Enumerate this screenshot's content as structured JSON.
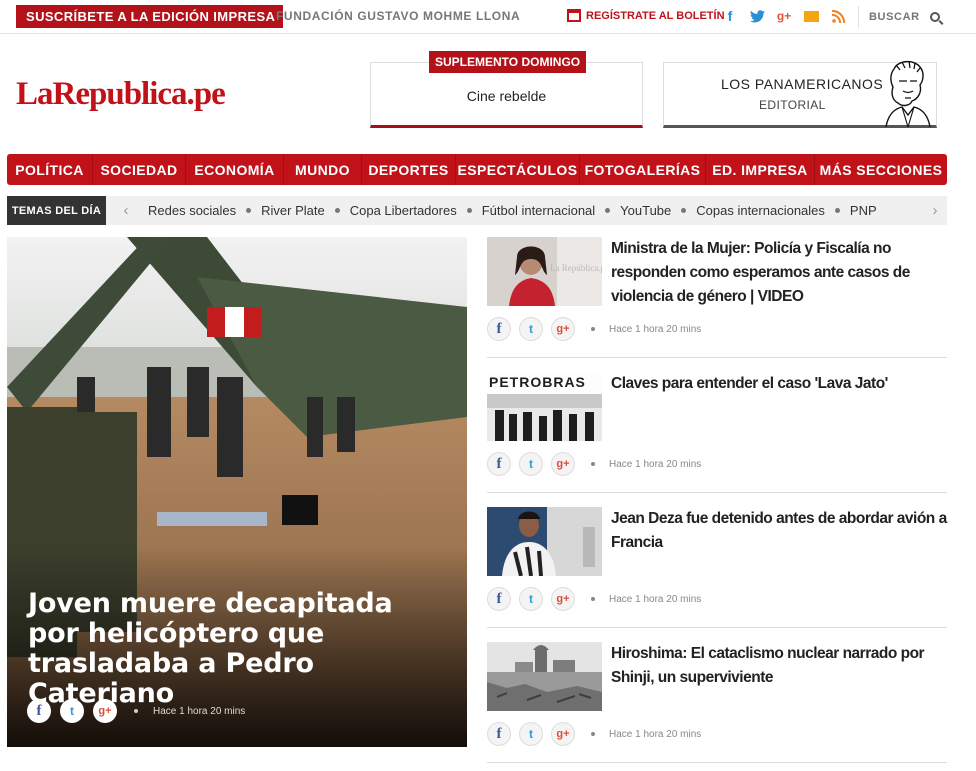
{
  "topbar": {
    "subscribe": "SUSCRÍBETE A LA EDICIÓN IMPRESA",
    "foundation": "FUNDACIÓN GUSTAVO MOHME LLONA",
    "newsletter": "REGÍSTRATE AL BOLETÍN",
    "social_icons": [
      "facebook-icon",
      "twitter-icon",
      "google-plus-icon",
      "mail-icon",
      "rss-icon"
    ],
    "search_placeholder": "BUSCAR"
  },
  "logo": "LaRepublica.pe",
  "supplement": {
    "tag": "SUPLEMENTO DOMINGO",
    "title": "Cine rebelde"
  },
  "columnist": {
    "name": "LOS PANAMERICANOS",
    "section": "EDITORIAL"
  },
  "nav": [
    "POLÍTICA",
    "SOCIEDAD",
    "ECONOMÍA",
    "MUNDO",
    "DEPORTES",
    "ESPECTÁCULOS",
    "FOTOGALERÍAS",
    "ED. IMPRESA",
    "MÁS SECCIONES"
  ],
  "topics": {
    "label": "TEMAS DEL DÍA",
    "items": [
      "Redes sociales",
      "River Plate",
      "Copa Libertadores",
      "Fútbol internacional",
      "YouTube",
      "Copas internacionales",
      "PNP"
    ]
  },
  "main_story": {
    "headline": "Joven muere decapitada por helicóptero que trasladaba a Pedro Cateriano",
    "time": "Hace 1 hora 20 mins"
  },
  "side_stories": [
    {
      "title": "Ministra de la Mujer: Policía y Fiscalía no responden como esperamos ante casos de violencia de género | VIDEO",
      "time": "Hace 1 hora 20 mins",
      "thumb_text": "La República.pe"
    },
    {
      "title": "Claves para entender el caso 'Lava Jato'",
      "time": "Hace 1 hora 20 mins",
      "thumb_text": "PETROBRAS"
    },
    {
      "title": "Jean Deza fue detenido antes de abordar avión a Francia",
      "time": "Hace 1 hora 20 mins"
    },
    {
      "title": "Hiroshima: El cataclismo nuclear narrado por Shinji, un superviviente",
      "time": "Hace 1 hora 20 mins"
    }
  ],
  "share": {
    "fb": "f",
    "tw": "t",
    "gp": "g+"
  },
  "colors": {
    "brand": "#c1121a",
    "dark": "#333333"
  }
}
